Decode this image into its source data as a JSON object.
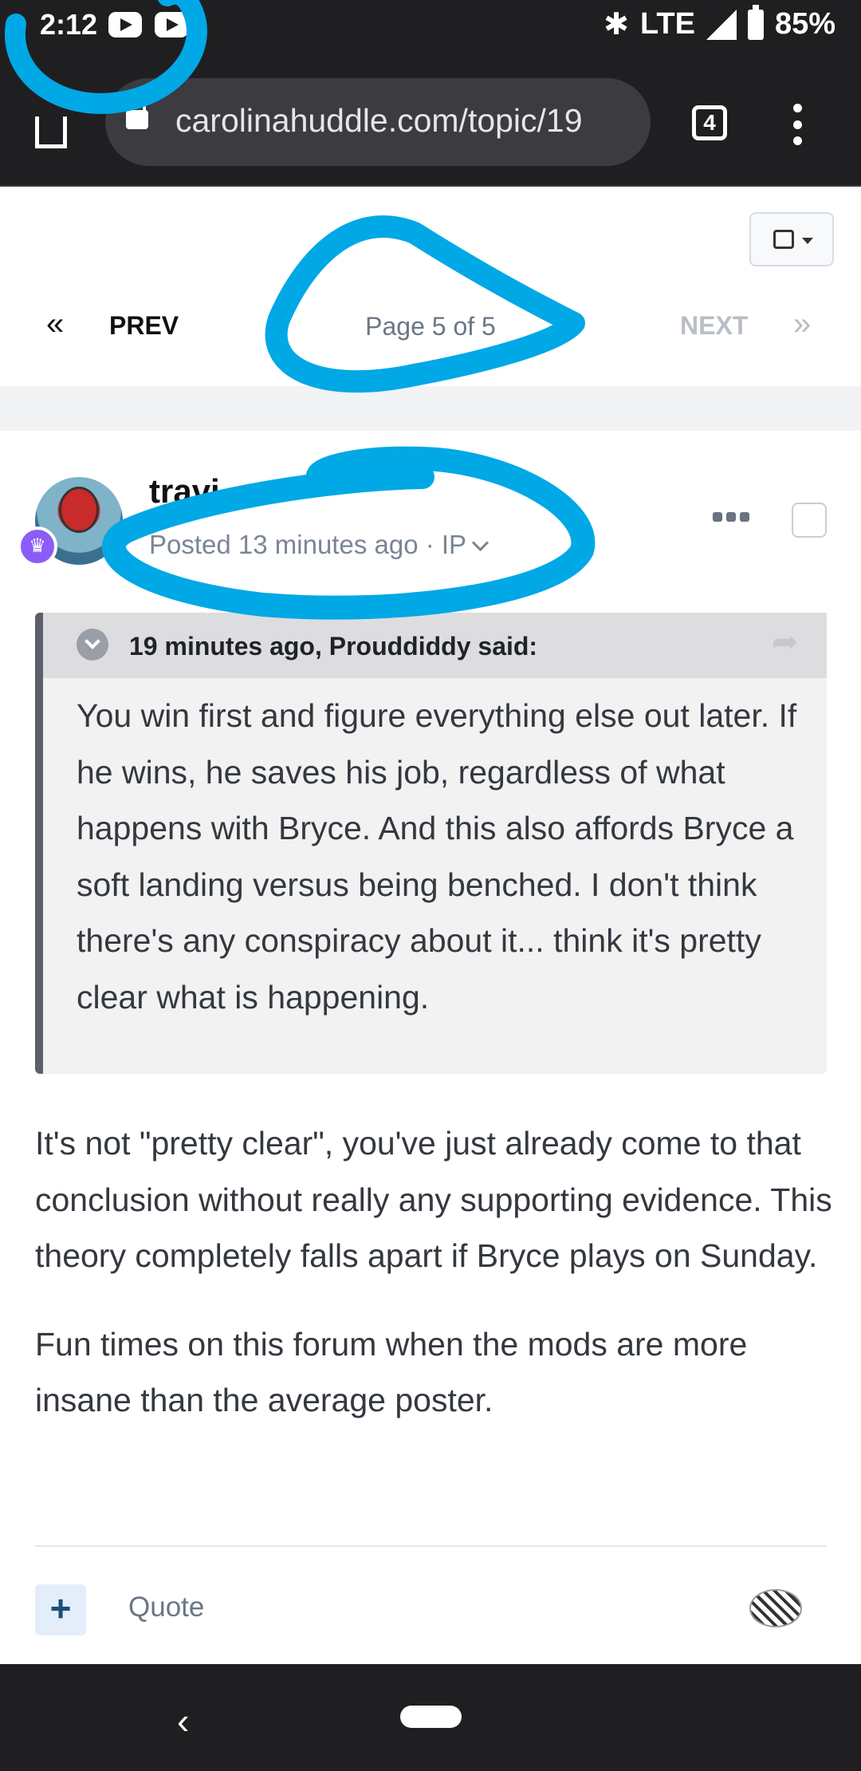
{
  "status_bar": {
    "time": "2:12",
    "network": "LTE",
    "battery": "85%",
    "icons": [
      "youtube-icon",
      "youtube-icon",
      "bluetooth-icon",
      "signal-icon",
      "battery-icon"
    ]
  },
  "browser": {
    "url": "carolinahuddle.com/topic/19",
    "tab_count": "4"
  },
  "pagination": {
    "prev_label": "PREV",
    "page_info": "Page 5 of 5",
    "next_label": "NEXT",
    "prev_icon": "«",
    "next_icon": "»"
  },
  "post": {
    "author": "travi",
    "meta": "Posted 13 minutes ago · IP",
    "quote": {
      "citation": "19 minutes ago, Prouddiddy said:",
      "paragraphs": [
        "You win first and figure everything else out later.  If he wins, he saves his job, regardless of what happens with Bryce.  And this also affords Bryce a soft landing versus being benched.  I don't think there's any conspiracy about it... think it's pretty clear what is happening."
      ]
    },
    "paragraphs": [
      "It's not \"pretty clear\", you've just already come to that conclusion without really any supporting evidence.  This theory completely falls apart if Bryce plays on Sunday.",
      "Fun times on this forum when the mods are more insane than the average poster."
    ],
    "actions": {
      "add_label": "+",
      "quote_label": "Quote"
    }
  },
  "nav_bar": {
    "back_icon": "‹"
  },
  "colors": {
    "system_bar": "#1f1f21",
    "markup_blue": "#00a8e6",
    "muted_text": "#6c7786"
  }
}
